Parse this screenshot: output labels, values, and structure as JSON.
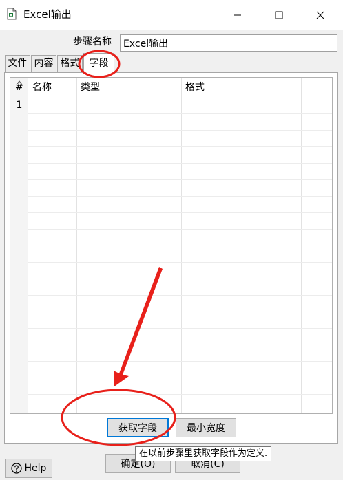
{
  "window": {
    "title": "Excel输出",
    "icon": "excel-file-icon",
    "controls": [
      "minimize-icon",
      "maximize-icon",
      "close-icon"
    ]
  },
  "step": {
    "label": "步骤名称",
    "value": "Excel输出"
  },
  "tabs": [
    {
      "label": "文件",
      "active": false
    },
    {
      "label": "内容",
      "active": false
    },
    {
      "label": "格式",
      "active": false
    },
    {
      "label": "字段",
      "active": true
    }
  ],
  "table": {
    "columns": [
      "#",
      "名称",
      "类型",
      "格式"
    ],
    "rows": [
      {
        "num": "1",
        "name": "",
        "type": "",
        "format": ""
      }
    ]
  },
  "buttons": {
    "get_fields": "获取字段",
    "min_width": "最小宽度",
    "ok": "确定(O)",
    "cancel": "取消(C)",
    "help": "Help"
  },
  "tooltip": "在以前步骤里获取字段作为定义.",
  "annotation_color": "#e8201a"
}
